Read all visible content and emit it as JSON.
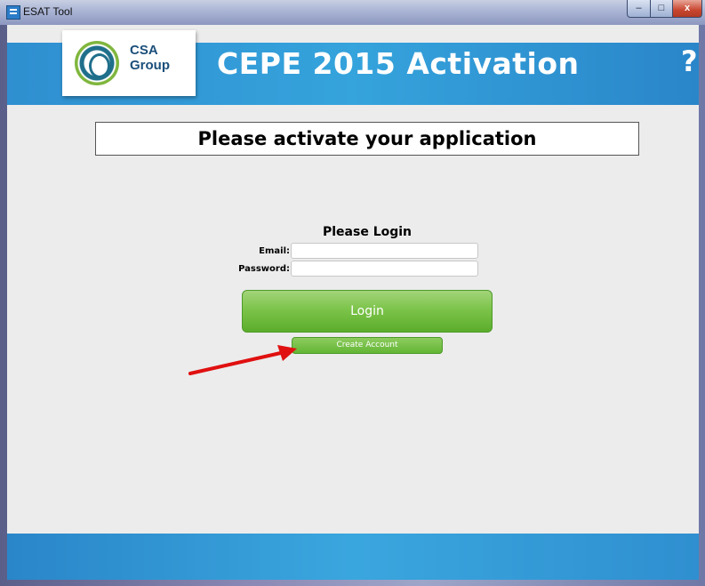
{
  "window": {
    "title": "ESAT Tool",
    "minimize_glyph": "–",
    "maximize_glyph": "□",
    "close_glyph": "x"
  },
  "header": {
    "logo_line1": "CSA",
    "logo_line2": "Group",
    "title": "CEPE 2015 Activation",
    "help_label": "?"
  },
  "banner": {
    "text": "Please activate your application"
  },
  "login": {
    "heading": "Please Login",
    "email_label": "Email:",
    "email_value": "",
    "password_label": "Password:",
    "password_value": "",
    "login_button": "Login",
    "create_account_button": "Create Account"
  },
  "colors": {
    "header_blue": "#35a3dc",
    "button_green": "#7cc44a",
    "annotation_red": "#e01010"
  }
}
